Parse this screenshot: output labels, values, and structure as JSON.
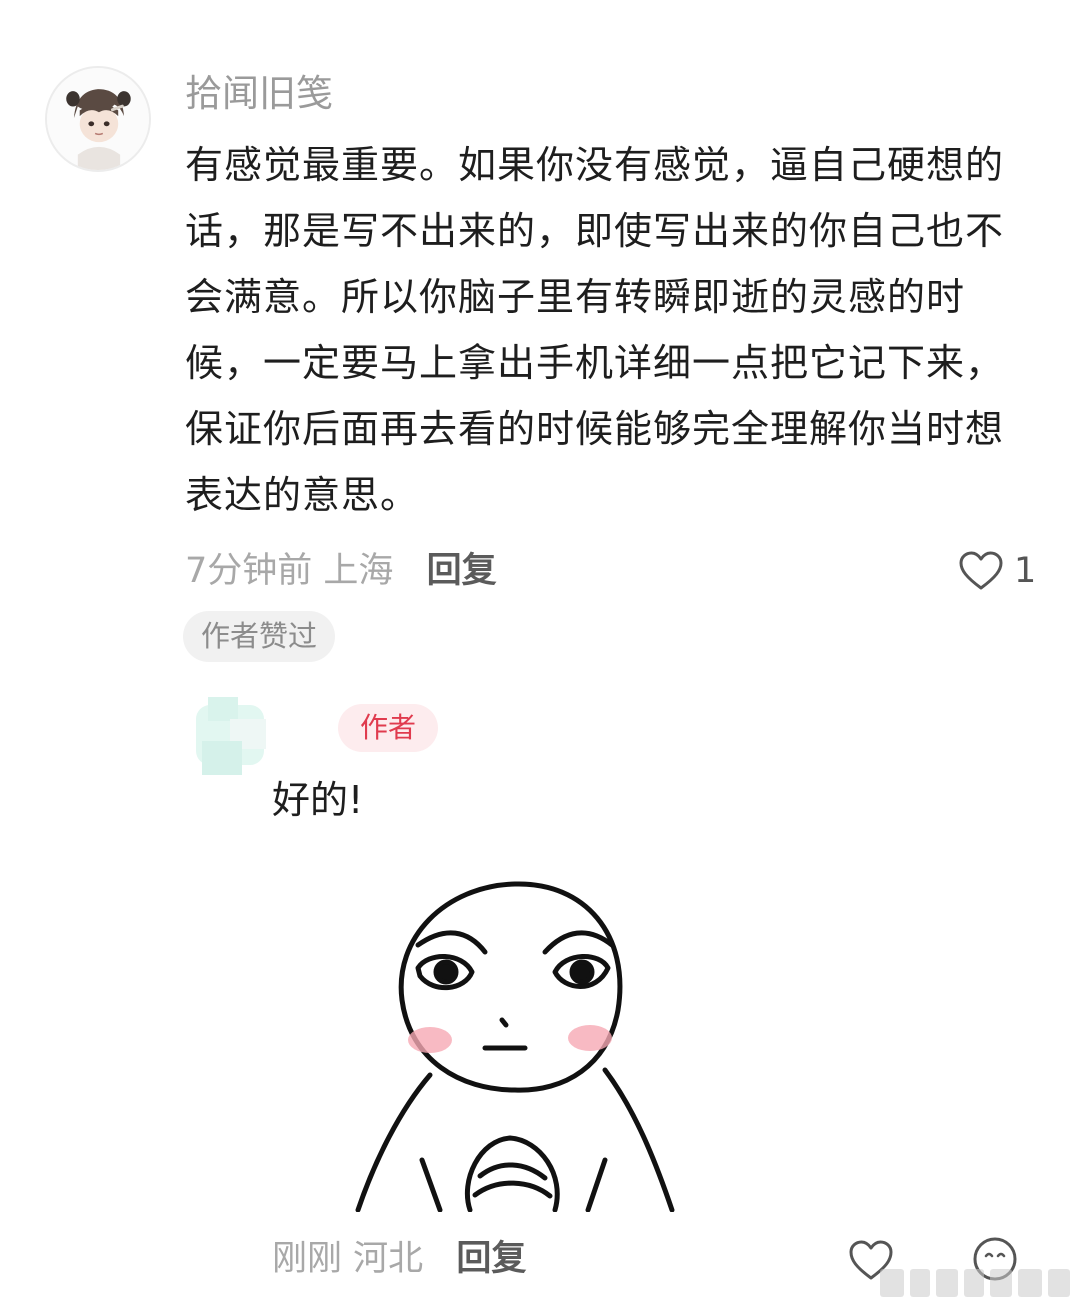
{
  "comment": {
    "username": "拾闻旧笺",
    "text": "有感觉最重要。如果你没有感觉，逼自己硬想的话，那是写不出来的，即使写出来的你自己也不会满意。所以你脑子里有转瞬即逝的灵感的时候，一定要马上拿出手机详细一点把它记下来，保证你后面再去看的时候能够完全理解你当时想表达的意思。",
    "time": "7分钟前",
    "location": "上海",
    "reply_label": "回复",
    "like_count": "1",
    "author_liked_badge": "作者赞过"
  },
  "reply": {
    "author_tag": "作者",
    "text": "好的!",
    "time": "刚刚",
    "location": "河北",
    "reply_label": "回复"
  },
  "colors": {
    "meta_gray": "#a8a8a8",
    "author_tag_red": "#e03b4e",
    "author_tag_bg": "#fdecee",
    "badge_bg": "#f1f1f1"
  },
  "icons": {
    "like": "heart-outline-icon",
    "emoji": "smile-face-icon"
  }
}
